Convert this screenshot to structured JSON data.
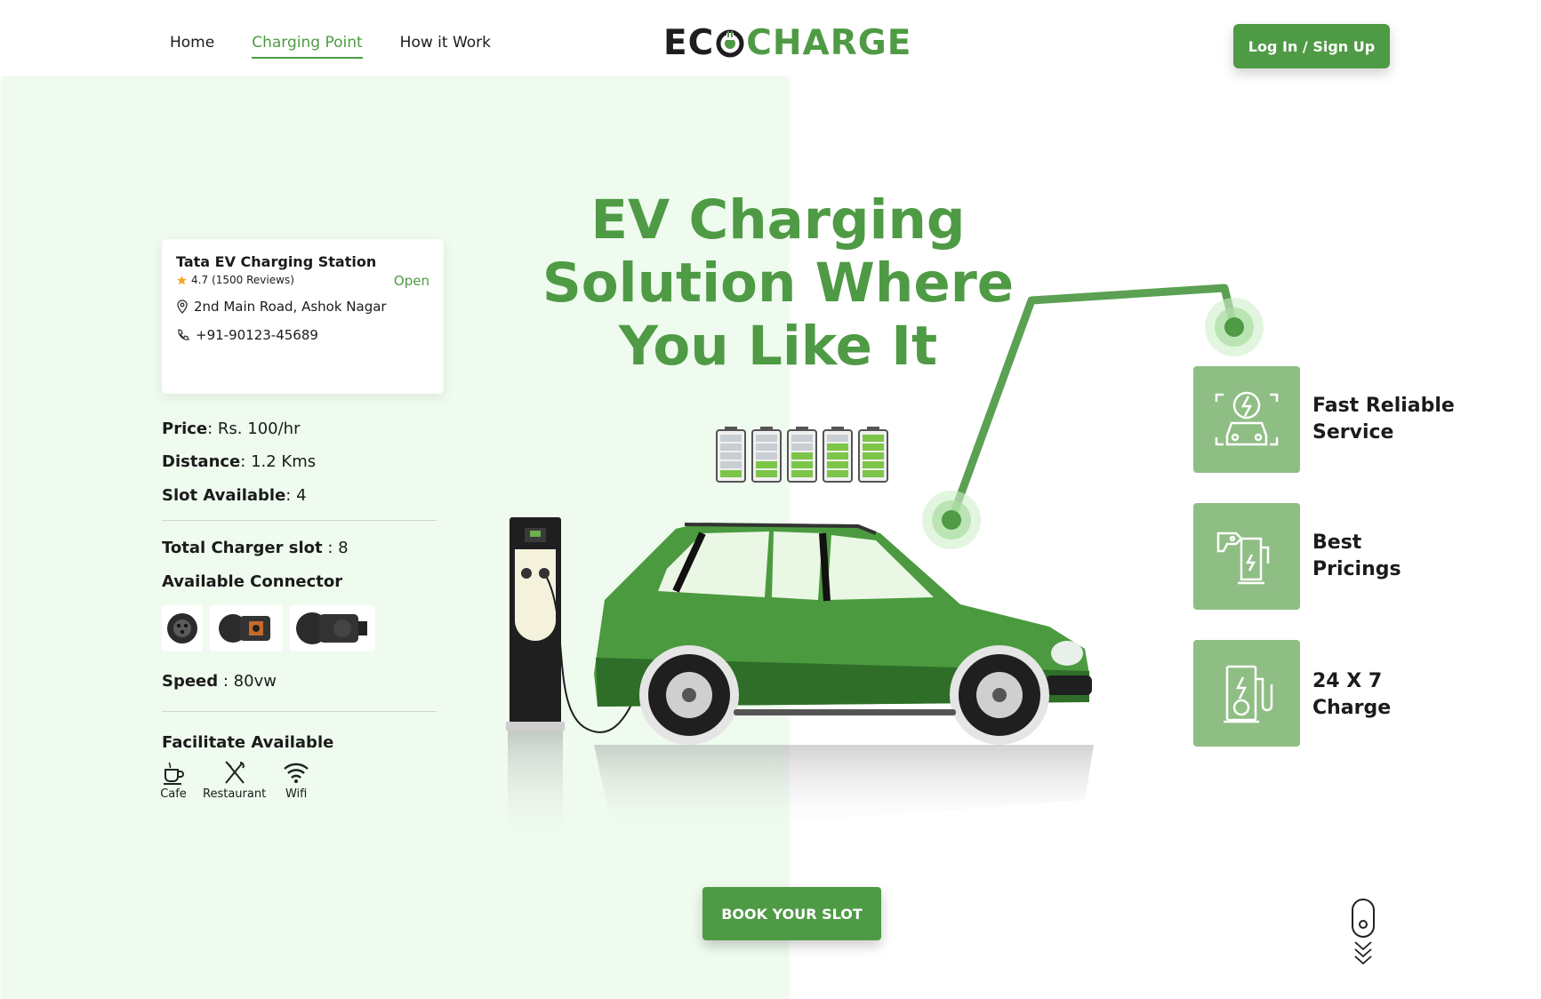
{
  "nav": {
    "items": [
      {
        "label": "Home"
      },
      {
        "label": "Charging Point"
      },
      {
        "label": "How it Work"
      }
    ],
    "active_index": 1
  },
  "logo": {
    "part1": "EC",
    "part2": "CHARGE"
  },
  "header": {
    "login_label": "Log In / Sign Up"
  },
  "station": {
    "name": "Tata EV Charging Station",
    "status": "Open",
    "rating": "4.7",
    "reviews": "(1500 Reviews)",
    "address": "2nd Main Road, Ashok Nagar",
    "phone": "+91-90123-45689"
  },
  "details": {
    "price_label": "Price",
    "price_value": ": Rs. 100/hr",
    "distance_label": "Distance",
    "distance_value": ": 1.2 Kms",
    "slot_label": "Slot Available",
    "slot_value": ": 4",
    "total_label": "Total Charger slot",
    "total_value": " : 8",
    "connector_heading": "Available Connector",
    "speed_label": "Speed",
    "speed_value": " : 80vw",
    "facilities_heading": "Facilitate Available"
  },
  "facilities": [
    {
      "label": "Cafe",
      "icon": "coffee-cup-icon"
    },
    {
      "label": "Restaurant",
      "icon": "fork-knife-icon"
    },
    {
      "label": "Wifi",
      "icon": "wifi-icon"
    }
  ],
  "hero": {
    "line1": "EV Charging",
    "line2": "Solution Where",
    "line3": "You Like It"
  },
  "battery_levels": [
    0.2,
    0.4,
    0.6,
    0.8,
    1.0
  ],
  "features": [
    {
      "line1": "Fast Reliable",
      "line2": "Service",
      "icon": "car-charging-icon"
    },
    {
      "line1": "Best",
      "line2": "Pricings",
      "icon": "price-plug-icon"
    },
    {
      "line1": "24 X 7",
      "line2": "Charge",
      "icon": "charging-station-icon"
    }
  ],
  "cta": {
    "book_label": "BOOK YOUR SLOT"
  },
  "colors": {
    "accent": "#4f9a45",
    "panel": "#eefbee",
    "feature_tile": "#8fbe84"
  }
}
